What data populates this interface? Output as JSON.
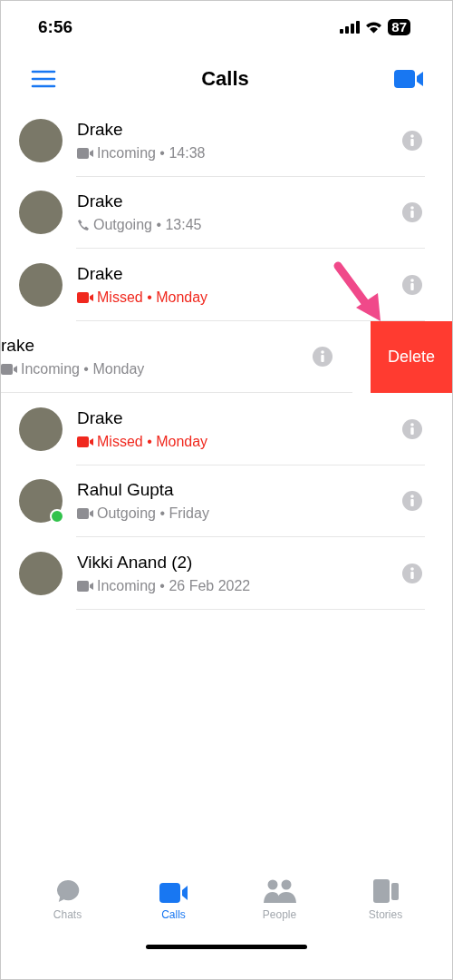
{
  "status_bar": {
    "time": "6:56",
    "battery": "87"
  },
  "header": {
    "title": "Calls"
  },
  "calls": [
    {
      "name": "Drake",
      "kind": "video",
      "detail": "Incoming • 14:38",
      "missed": false,
      "online": false,
      "swiped": false
    },
    {
      "name": "Drake",
      "kind": "audio",
      "detail": "Outgoing • 13:45",
      "missed": false,
      "online": false,
      "swiped": false
    },
    {
      "name": "Drake",
      "kind": "video",
      "detail": "Missed • Monday",
      "missed": true,
      "online": false,
      "swiped": false
    },
    {
      "name": "rake",
      "kind": "video",
      "detail": "Incoming • Monday",
      "missed": false,
      "swiped": true,
      "action": "Delete"
    },
    {
      "name": "Drake",
      "kind": "video",
      "detail": "Missed • Monday",
      "missed": true,
      "online": false,
      "swiped": false
    },
    {
      "name": "Rahul Gupta",
      "kind": "video",
      "detail": "Outgoing • Friday",
      "missed": false,
      "online": true,
      "swiped": false
    },
    {
      "name": "Vikki Anand (2)",
      "kind": "video",
      "detail": "Incoming • 26 Feb 2022",
      "missed": false,
      "online": false,
      "swiped": false
    }
  ],
  "tabs": [
    {
      "label": "Chats",
      "kind": "chats",
      "selected": false
    },
    {
      "label": "Calls",
      "kind": "calls",
      "selected": true
    },
    {
      "label": "People",
      "kind": "people",
      "selected": false
    },
    {
      "label": "Stories",
      "kind": "stories",
      "selected": false
    }
  ]
}
